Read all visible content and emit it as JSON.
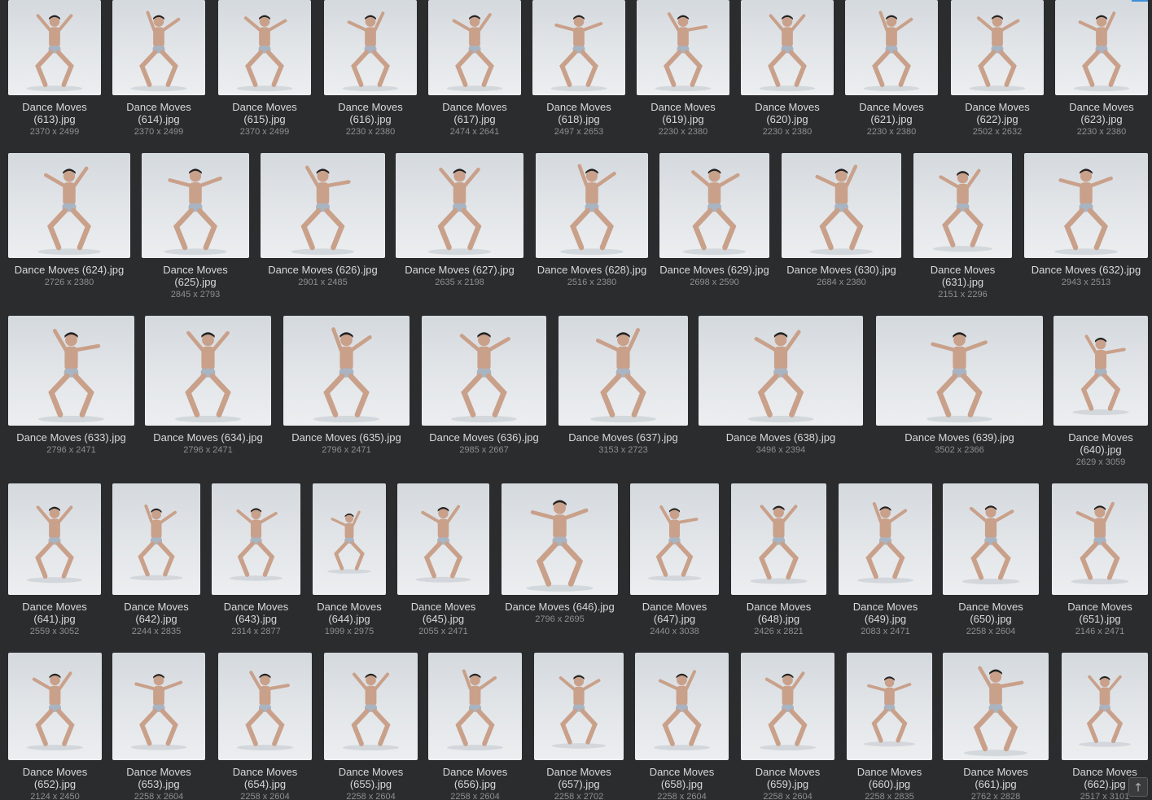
{
  "gallery": {
    "rows": [
      [
        {
          "name": "Dance Moves (613).jpg",
          "dims": "2370 x 2499",
          "lines": [
            "Dance Moves",
            "(613).jpg"
          ]
        },
        {
          "name": "Dance Moves (614).jpg",
          "dims": "2370 x 2499",
          "lines": [
            "Dance Moves",
            "(614).jpg"
          ]
        },
        {
          "name": "Dance Moves (615).jpg",
          "dims": "2370 x 2499",
          "lines": [
            "Dance Moves",
            "(615).jpg"
          ]
        },
        {
          "name": "Dance Moves (616).jpg",
          "dims": "2230 x 2380",
          "lines": [
            "Dance Moves",
            "(616).jpg"
          ]
        },
        {
          "name": "Dance Moves (617).jpg",
          "dims": "2474 x 2641",
          "lines": [
            "Dance Moves",
            "(617).jpg"
          ]
        },
        {
          "name": "Dance Moves (618).jpg",
          "dims": "2497 x 2653",
          "lines": [
            "Dance Moves",
            "(618).jpg"
          ]
        },
        {
          "name": "Dance Moves (619).jpg",
          "dims": "2230 x 2380",
          "lines": [
            "Dance Moves",
            "(619).jpg"
          ]
        },
        {
          "name": "Dance Moves (620).jpg",
          "dims": "2230 x 2380",
          "lines": [
            "Dance Moves",
            "(620).jpg"
          ]
        },
        {
          "name": "Dance Moves (621).jpg",
          "dims": "2230 x 2380",
          "lines": [
            "Dance Moves",
            "(621).jpg"
          ]
        },
        {
          "name": "Dance Moves (622).jpg",
          "dims": "2502 x 2632",
          "lines": [
            "Dance Moves",
            "(622).jpg"
          ]
        },
        {
          "name": "Dance Moves (623).jpg",
          "dims": "2230 x 2380",
          "lines": [
            "Dance Moves",
            "(623).jpg"
          ]
        }
      ],
      [
        {
          "name": "Dance Moves (624).jpg",
          "dims": "2726 x 2380",
          "lines": [
            "Dance Moves (624).jpg"
          ]
        },
        {
          "name": "Dance Moves (625).jpg",
          "dims": "2845 x 2793",
          "lines": [
            "Dance Moves",
            "(625).jpg"
          ]
        },
        {
          "name": "Dance Moves (626).jpg",
          "dims": "2901 x 2485",
          "lines": [
            "Dance Moves (626).jpg"
          ]
        },
        {
          "name": "Dance Moves (627).jpg",
          "dims": "2635 x 2198",
          "lines": [
            "Dance Moves (627).jpg"
          ]
        },
        {
          "name": "Dance Moves (628).jpg",
          "dims": "2516 x 2380",
          "lines": [
            "Dance Moves (628).jpg"
          ]
        },
        {
          "name": "Dance Moves (629).jpg",
          "dims": "2698 x 2590",
          "lines": [
            "Dance Moves (629).jpg"
          ]
        },
        {
          "name": "Dance Moves (630).jpg",
          "dims": "2684 x 2380",
          "lines": [
            "Dance Moves (630).jpg"
          ]
        },
        {
          "name": "Dance Moves (631).jpg",
          "dims": "2151 x 2296",
          "lines": [
            "Dance Moves",
            "(631).jpg"
          ]
        },
        {
          "name": "Dance Moves (632).jpg",
          "dims": "2943 x 2513",
          "lines": [
            "Dance Moves (632).jpg"
          ]
        }
      ],
      [
        {
          "name": "Dance Moves (633).jpg",
          "dims": "2796 x 2471",
          "lines": [
            "Dance Moves (633).jpg"
          ]
        },
        {
          "name": "Dance Moves (634).jpg",
          "dims": "2796 x 2471",
          "lines": [
            "Dance Moves (634).jpg"
          ]
        },
        {
          "name": "Dance Moves (635).jpg",
          "dims": "2796 x 2471",
          "lines": [
            "Dance Moves (635).jpg"
          ]
        },
        {
          "name": "Dance Moves (636).jpg",
          "dims": "2985 x 2667",
          "lines": [
            "Dance Moves (636).jpg"
          ]
        },
        {
          "name": "Dance Moves (637).jpg",
          "dims": "3153 x 2723",
          "lines": [
            "Dance Moves (637).jpg"
          ]
        },
        {
          "name": "Dance Moves (638).jpg",
          "dims": "3496 x 2394",
          "lines": [
            "Dance Moves (638).jpg"
          ]
        },
        {
          "name": "Dance Moves (639).jpg",
          "dims": "3502 x 2366",
          "lines": [
            "Dance Moves (639).jpg"
          ]
        },
        {
          "name": "Dance Moves (640).jpg",
          "dims": "2629 x 3059",
          "lines": [
            "Dance Moves",
            "(640).jpg"
          ]
        }
      ],
      [
        {
          "name": "Dance Moves (641).jpg",
          "dims": "2559 x 3052",
          "lines": [
            "Dance Moves",
            "(641).jpg"
          ]
        },
        {
          "name": "Dance Moves (642).jpg",
          "dims": "2244 x 2835",
          "lines": [
            "Dance Moves",
            "(642).jpg"
          ]
        },
        {
          "name": "Dance Moves (643).jpg",
          "dims": "2314 x 2877",
          "lines": [
            "Dance Moves",
            "(643).jpg"
          ]
        },
        {
          "name": "Dance Moves (644).jpg",
          "dims": "1999 x 2975",
          "lines": [
            "Dance Moves",
            "(644).jpg"
          ]
        },
        {
          "name": "Dance Moves (645).jpg",
          "dims": "2055 x 2471",
          "lines": [
            "Dance Moves",
            "(645).jpg"
          ]
        },
        {
          "name": "Dance Moves (646).jpg",
          "dims": "2796 x 2695",
          "lines": [
            "Dance Moves (646).jpg"
          ]
        },
        {
          "name": "Dance Moves (647).jpg",
          "dims": "2440 x 3038",
          "lines": [
            "Dance Moves",
            "(647).jpg"
          ]
        },
        {
          "name": "Dance Moves (648).jpg",
          "dims": "2426 x 2821",
          "lines": [
            "Dance Moves",
            "(648).jpg"
          ]
        },
        {
          "name": "Dance Moves (649).jpg",
          "dims": "2083 x 2471",
          "lines": [
            "Dance Moves",
            "(649).jpg"
          ]
        },
        {
          "name": "Dance Moves (650).jpg",
          "dims": "2258 x 2604",
          "lines": [
            "Dance Moves",
            "(650).jpg"
          ]
        },
        {
          "name": "Dance Moves (651).jpg",
          "dims": "2146 x 2471",
          "lines": [
            "Dance Moves",
            "(651).jpg"
          ]
        }
      ],
      [
        {
          "name": "Dance Moves (652).jpg",
          "dims": "2124 x 2450",
          "lines": [
            "Dance Moves",
            "(652).jpg"
          ]
        },
        {
          "name": "Dance Moves (653).jpg",
          "dims": "2258 x 2604",
          "lines": [
            "Dance Moves",
            "(653).jpg"
          ]
        },
        {
          "name": "Dance Moves (654).jpg",
          "dims": "2258 x 2604",
          "lines": [
            "Dance Moves",
            "(654).jpg"
          ]
        },
        {
          "name": "Dance Moves (655).jpg",
          "dims": "2258 x 2604",
          "lines": [
            "Dance Moves",
            "(655).jpg"
          ]
        },
        {
          "name": "Dance Moves (656).jpg",
          "dims": "2258 x 2604",
          "lines": [
            "Dance Moves",
            "(656).jpg"
          ]
        },
        {
          "name": "Dance Moves (657).jpg",
          "dims": "2258 x 2702",
          "lines": [
            "Dance Moves",
            "(657).jpg"
          ]
        },
        {
          "name": "Dance Moves (658).jpg",
          "dims": "2258 x 2604",
          "lines": [
            "Dance Moves",
            "(658).jpg"
          ]
        },
        {
          "name": "Dance Moves (659).jpg",
          "dims": "2258 x 2604",
          "lines": [
            "Dance Moves",
            "(659).jpg"
          ]
        },
        {
          "name": "Dance Moves (660).jpg",
          "dims": "2258 x 2835",
          "lines": [
            "Dance Moves",
            "(660).jpg"
          ]
        },
        {
          "name": "Dance Moves (661).jpg",
          "dims": "2762 x 2828",
          "lines": [
            "Dance Moves",
            "(661).jpg"
          ]
        },
        {
          "name": "Dance Moves (662).jpg",
          "dims": "2517 x 3101",
          "lines": [
            "Dance Moves",
            "(662).jpg"
          ]
        }
      ]
    ]
  },
  "scroll_top": {
    "icon": "arrow-up-icon",
    "glyph": "🡑"
  },
  "colors": {
    "background": "#2b2c2e",
    "filename": "#d9d9d9",
    "dimensions": "#8f8f8f",
    "accent": "#3d8fd8"
  }
}
